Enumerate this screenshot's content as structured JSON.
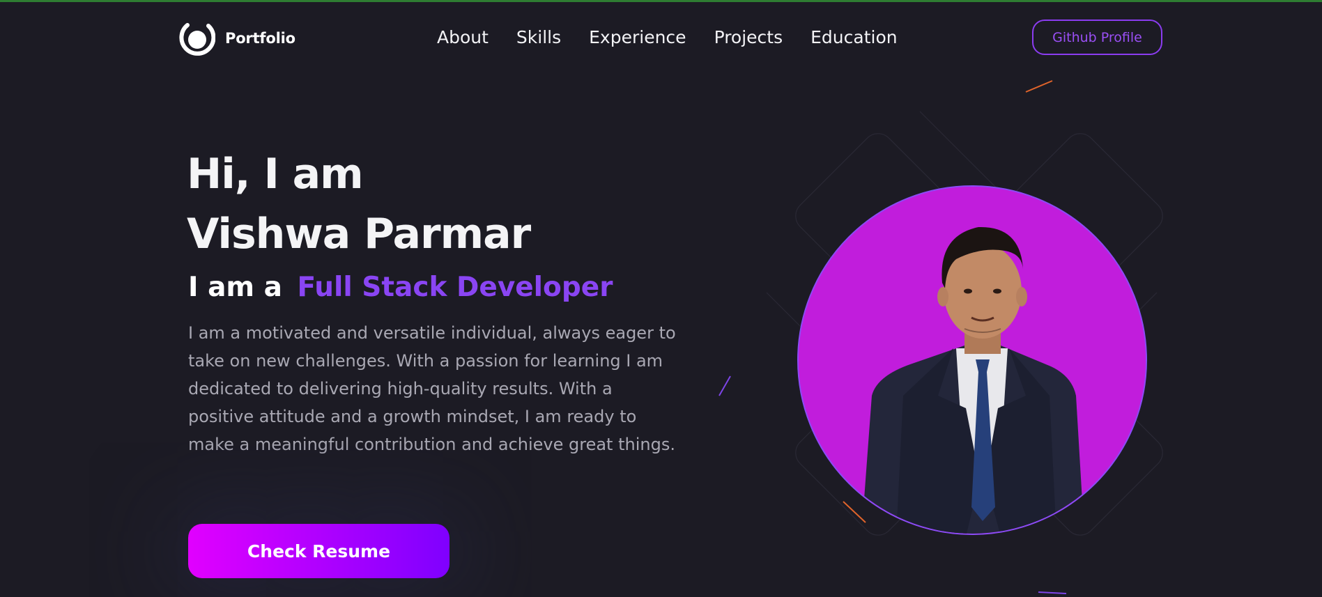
{
  "nav": {
    "brand": "Portfolio",
    "links": [
      "About",
      "Skills",
      "Experience",
      "Projects",
      "Education"
    ],
    "github_label": "Github Profile"
  },
  "hero": {
    "greeting": "Hi, I am",
    "name": "Vishwa Parmar",
    "role_prefix": "I am a",
    "role_title": "Full Stack Developer",
    "bio": "I am a motivated and versatile individual, always eager to take on new challenges. With a passion for learning I am dedicated to delivering high-quality results. With a positive attitude and a growth mindset, I am ready to make a meaningful contribution and achieve great things.",
    "resume_label": "Check Resume"
  },
  "colors": {
    "background": "#1c1b24",
    "accent": "#8a45f3",
    "button_gradient_start": "#e100ff",
    "button_gradient_end": "#7f00ff",
    "photo_background": "#c11ddc"
  },
  "icons": {
    "logo": "portfolio-logo-icon"
  }
}
